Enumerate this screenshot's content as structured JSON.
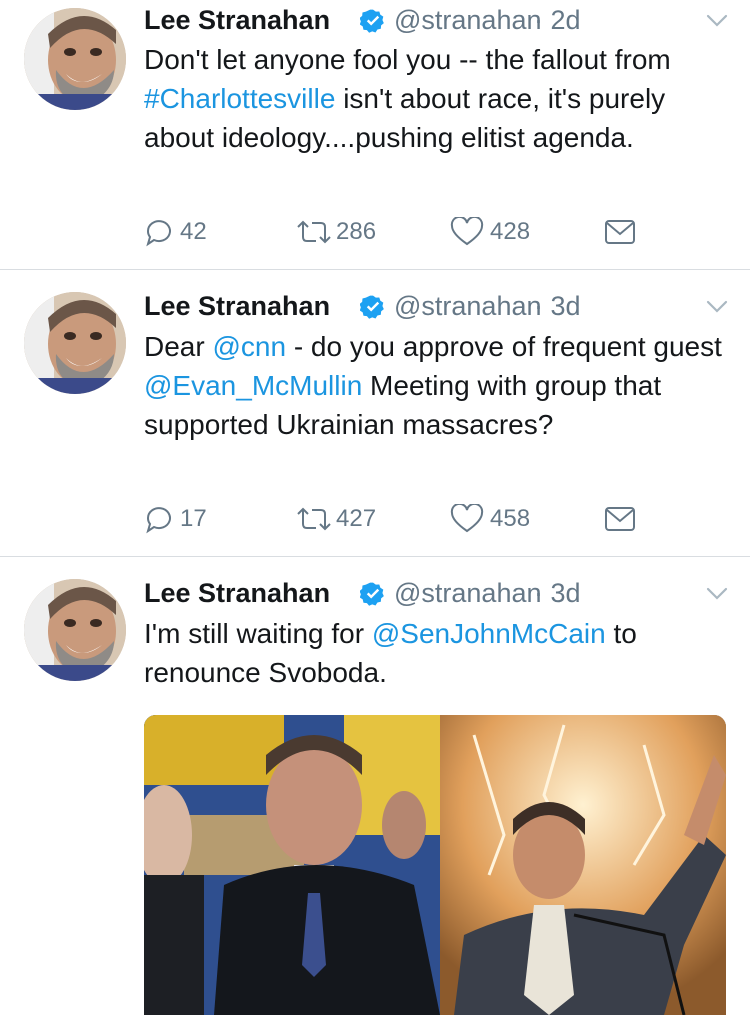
{
  "tweets": [
    {
      "name": "Lee Stranahan",
      "handle": "@stranahan",
      "time": "· 2d",
      "text_parts": [
        "Don't let anyone fool you -- the fallout from ",
        "#Charlottesville",
        " isn't about race, it's purely about ideology....pushing elitist agenda."
      ],
      "replies": "42",
      "retweets": "286",
      "likes": "428"
    },
    {
      "name": "Lee Stranahan",
      "handle": "@stranahan",
      "time": "· 3d",
      "text_parts": [
        "Dear ",
        "@cnn",
        " - do you approve of frequent guest ",
        "@Evan_McMullin",
        " Meeting with group that supported Ukrainian massacres?"
      ],
      "replies": "17",
      "retweets": "427",
      "likes": "458"
    },
    {
      "name": "Lee Stranahan",
      "handle": "@stranahan",
      "time": "· 3d",
      "text_parts": [
        "I'm still waiting for ",
        "@SenJohnMcCain",
        " to renounce Svoboda."
      ]
    }
  ],
  "icons": {
    "verified": "verified-badge-icon",
    "chevron": "chevron-down-icon",
    "reply": "reply-icon",
    "retweet": "retweet-icon",
    "like": "heart-icon",
    "dm": "envelope-icon"
  },
  "colors": {
    "link": "#1b95e0",
    "secondary_text": "#657786",
    "verified": "#1da1f2"
  }
}
